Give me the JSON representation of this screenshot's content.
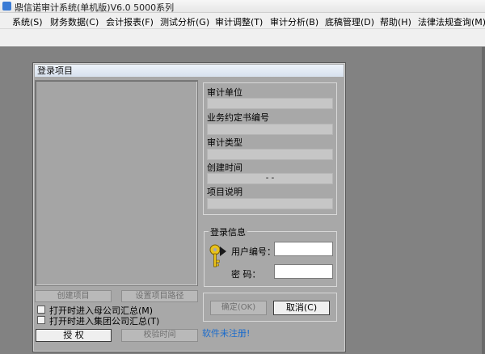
{
  "window": {
    "title": "鼎信诺审计系统(单机版)V6.0 5000系列"
  },
  "menu": [
    "系统(S)",
    "财务数据(C)",
    "会计报表(F)",
    "测试分析(G)",
    "审计调整(T)",
    "审计分析(B)",
    "底稿管理(D)",
    "帮助(H)",
    "法律法规查询(M)"
  ],
  "dialog": {
    "title": "登录项目",
    "info": {
      "audit_unit_label": "审计单位",
      "contract_no_label": "业务约定书编号",
      "audit_type_label": "审计类型",
      "created_time_label": "创建时间",
      "created_time_value": "-  -",
      "project_desc_label": "项目说明"
    },
    "login": {
      "group_label": "登录信息",
      "user_id_label": "用户编号：",
      "password_label": "密    码：",
      "user_id_value": "",
      "password_value": ""
    },
    "buttons": {
      "create_project": "创建项目",
      "set_project_path": "设置项目路径",
      "confirm": "确定(OK)",
      "cancel": "取消(C)",
      "authorize": "授  权",
      "calibrate_time": "校验时间"
    },
    "checkboxes": {
      "parent_summary": "打开时进入母公司汇总(M)",
      "group_summary": "打开时进入集团公司汇总(T)"
    },
    "unregistered_text": "软件未注册!"
  }
}
